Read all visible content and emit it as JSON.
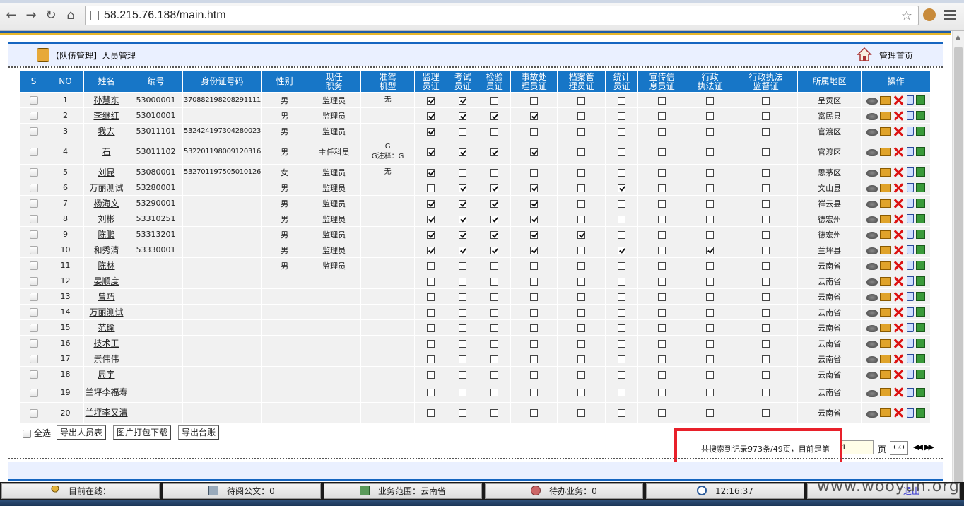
{
  "browser": {
    "url": "58.215.76.188/main.htm"
  },
  "header": {
    "title": "【队伍管理】人员管理",
    "home_link": "管理首页"
  },
  "table": {
    "columns": [
      "S",
      "NO",
      "姓名",
      "编号",
      "身份证号码",
      "性别",
      "现任\n职务",
      "准驾\n机型",
      "监理\n员证",
      "考试\n员证",
      "检验\n员证",
      "事故处\n理员证",
      "档案管\n理员证",
      "统计\n员证",
      "宣传信\n息员证",
      "行政\n执法证",
      "行政执法\n监督证",
      "所属地区",
      "操作"
    ],
    "rows": [
      {
        "no": "1",
        "name": "孙慧东",
        "code": "53000001",
        "id": "370882198208291111",
        "gender": "男",
        "post": "监理员",
        "license": "无",
        "certs": [
          1,
          1,
          0,
          0,
          0,
          0,
          0,
          0,
          0
        ],
        "region": "呈贡区"
      },
      {
        "no": "2",
        "name": "李继红",
        "code": "53010001",
        "id": "",
        "gender": "男",
        "post": "监理员",
        "license": "",
        "certs": [
          1,
          1,
          1,
          1,
          0,
          0,
          0,
          0,
          0
        ],
        "region": "富民县"
      },
      {
        "no": "3",
        "name": "我去",
        "code": "53011101",
        "id": "532424197304280023",
        "gender": "男",
        "post": "监理员",
        "license": "",
        "certs": [
          1,
          0,
          0,
          0,
          0,
          0,
          0,
          0,
          0
        ],
        "region": "官渡区"
      },
      {
        "no": "4",
        "name": "石",
        "code": "53011102",
        "id": "532201198009120316",
        "gender": "男",
        "post": "主任科员",
        "license": "G\nG注释：G",
        "certs": [
          1,
          1,
          1,
          1,
          0,
          0,
          0,
          0,
          0
        ],
        "region": "官渡区"
      },
      {
        "no": "5",
        "name": "刘昆",
        "code": "53080001",
        "id": "532701197505010126",
        "gender": "女",
        "post": "监理员",
        "license": "无",
        "certs": [
          1,
          0,
          0,
          0,
          0,
          0,
          0,
          0,
          0
        ],
        "region": "思茅区"
      },
      {
        "no": "6",
        "name": "万丽测试",
        "code": "53280001",
        "id": "",
        "gender": "男",
        "post": "监理员",
        "license": "",
        "certs": [
          0,
          1,
          1,
          1,
          0,
          1,
          0,
          0,
          0
        ],
        "region": "文山县"
      },
      {
        "no": "7",
        "name": "杨海文",
        "code": "53290001",
        "id": "",
        "gender": "男",
        "post": "监理员",
        "license": "",
        "certs": [
          1,
          1,
          1,
          1,
          0,
          0,
          0,
          0,
          0
        ],
        "region": "祥云县"
      },
      {
        "no": "8",
        "name": "刘彬",
        "code": "53310251",
        "id": "",
        "gender": "男",
        "post": "监理员",
        "license": "",
        "certs": [
          1,
          1,
          1,
          1,
          0,
          0,
          0,
          0,
          0
        ],
        "region": "德宏州"
      },
      {
        "no": "9",
        "name": "陈鹏",
        "code": "53313201",
        "id": "",
        "gender": "男",
        "post": "监理员",
        "license": "",
        "certs": [
          1,
          1,
          1,
          1,
          1,
          0,
          0,
          0,
          0
        ],
        "region": "德宏州"
      },
      {
        "no": "10",
        "name": "和秀清",
        "code": "53330001",
        "id": "",
        "gender": "男",
        "post": "监理员",
        "license": "",
        "certs": [
          1,
          1,
          1,
          1,
          0,
          1,
          0,
          1,
          0
        ],
        "region": "兰坪县"
      },
      {
        "no": "11",
        "name": "陈林",
        "code": "",
        "id": "",
        "gender": "男",
        "post": "监理员",
        "license": "",
        "certs": [
          0,
          0,
          0,
          0,
          0,
          0,
          0,
          0,
          0
        ],
        "region": "云南省"
      },
      {
        "no": "12",
        "name": "晏顺度",
        "code": "",
        "id": "",
        "gender": "",
        "post": "",
        "license": "",
        "certs": [
          0,
          0,
          0,
          0,
          0,
          0,
          0,
          0,
          0
        ],
        "region": "云南省"
      },
      {
        "no": "13",
        "name": "曾巧",
        "code": "",
        "id": "",
        "gender": "",
        "post": "",
        "license": "",
        "certs": [
          0,
          0,
          0,
          0,
          0,
          0,
          0,
          0,
          0
        ],
        "region": "云南省"
      },
      {
        "no": "14",
        "name": "万丽测试",
        "code": "",
        "id": "",
        "gender": "",
        "post": "",
        "license": "",
        "certs": [
          0,
          0,
          0,
          0,
          0,
          0,
          0,
          0,
          0
        ],
        "region": "云南省"
      },
      {
        "no": "15",
        "name": "范瑜",
        "code": "",
        "id": "",
        "gender": "",
        "post": "",
        "license": "",
        "certs": [
          0,
          0,
          0,
          0,
          0,
          0,
          0,
          0,
          0
        ],
        "region": "云南省"
      },
      {
        "no": "16",
        "name": "技术王",
        "code": "",
        "id": "",
        "gender": "",
        "post": "",
        "license": "",
        "certs": [
          0,
          0,
          0,
          0,
          0,
          0,
          0,
          0,
          0
        ],
        "region": "云南省"
      },
      {
        "no": "17",
        "name": "崇伟伟",
        "code": "",
        "id": "",
        "gender": "",
        "post": "",
        "license": "",
        "certs": [
          0,
          0,
          0,
          0,
          0,
          0,
          0,
          0,
          0
        ],
        "region": "云南省"
      },
      {
        "no": "18",
        "name": "周宇",
        "code": "",
        "id": "",
        "gender": "",
        "post": "",
        "license": "",
        "certs": [
          0,
          0,
          0,
          0,
          0,
          0,
          0,
          0,
          0
        ],
        "region": "云南省"
      },
      {
        "no": "19",
        "name": "兰坪李福寿",
        "code": "",
        "id": "",
        "gender": "",
        "post": "",
        "license": "",
        "certs": [
          0,
          0,
          0,
          0,
          0,
          0,
          0,
          0,
          0
        ],
        "region": "云南省"
      },
      {
        "no": "20",
        "name": "兰坪李又清",
        "code": "",
        "id": "",
        "gender": "",
        "post": "",
        "license": "",
        "certs": [
          0,
          0,
          0,
          0,
          0,
          0,
          0,
          0,
          0
        ],
        "region": "云南省"
      }
    ]
  },
  "controls": {
    "select_all": "全选",
    "export_staff": "导出人员表",
    "download_photos": "图片打包下载",
    "export_ledger": "导出台账"
  },
  "pager": {
    "summary": "共搜索到记录973条/49页，目前是第",
    "current_page": "1",
    "page_unit": "页",
    "go": "GO",
    "first": "◀◀",
    "last": "▶▶"
  },
  "status": {
    "online": "目前在线：",
    "pending_docs": "待阅公文：0",
    "scope": "业务范围：云南省",
    "todo": "待办业务：0",
    "time": "12:16:37",
    "exit": "退出"
  },
  "watermark": "www.wooyun.org",
  "colors": {
    "header_blue": "#1776c7",
    "rule_blue": "#1565c0",
    "stripe_gold": "#e7b62a",
    "highlight_red": "#e8202a"
  }
}
